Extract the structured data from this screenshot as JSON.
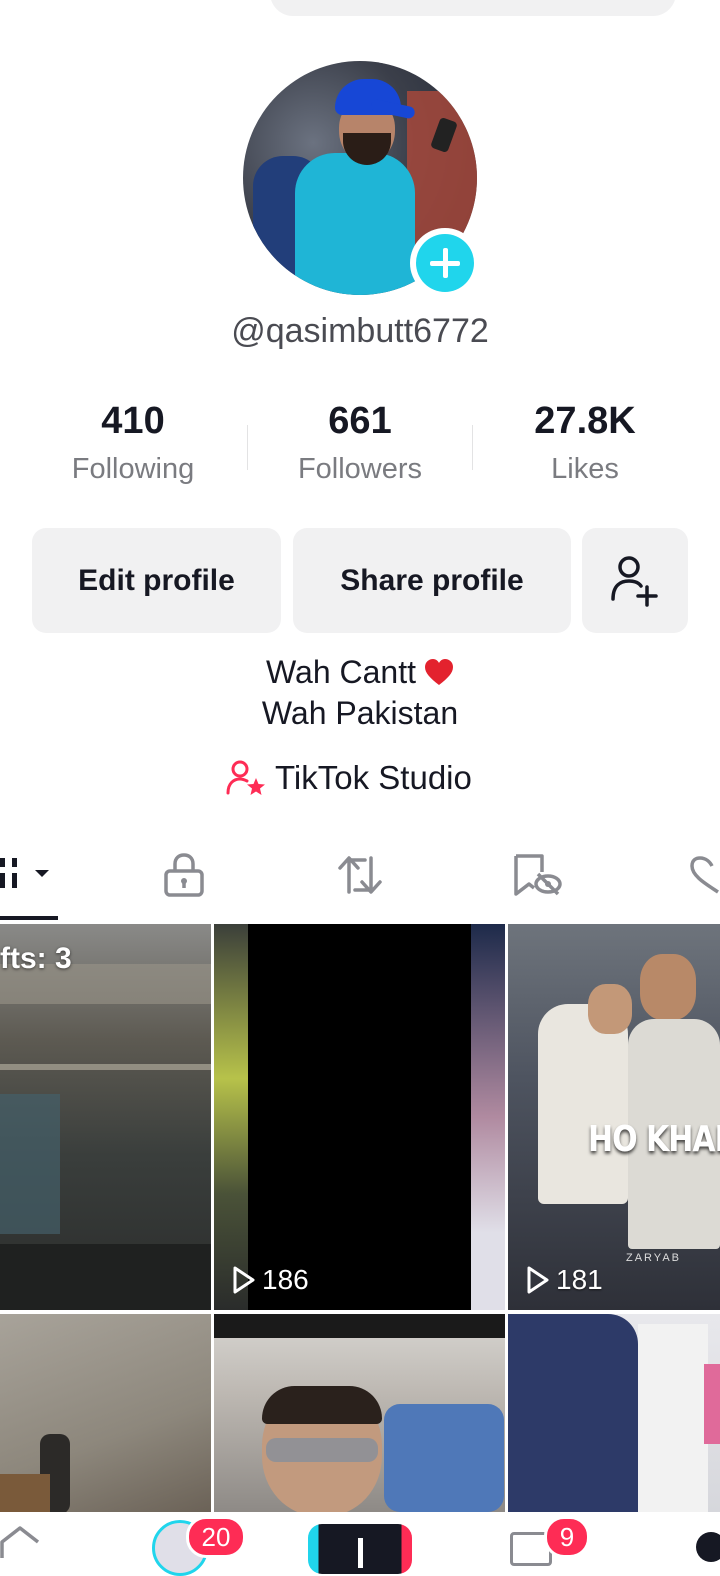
{
  "profile": {
    "username": "@qasimbutt6772",
    "stats": [
      {
        "value": "410",
        "label": "Following"
      },
      {
        "value": "661",
        "label": "Followers"
      },
      {
        "value": "27.8K",
        "label": "Likes"
      }
    ],
    "buttons": {
      "edit": "Edit profile",
      "share": "Share profile"
    },
    "bio": [
      "Wah Cantt",
      "Wah Pakistan"
    ],
    "studio_link": "TikTok Studio"
  },
  "tabs": [
    {
      "icon": "grid-icon",
      "active": true
    },
    {
      "icon": "lock-icon"
    },
    {
      "icon": "repost-icon"
    },
    {
      "icon": "favorites-hidden-icon"
    },
    {
      "icon": "liked-icon"
    }
  ],
  "grid": {
    "drafts_label": "fts: 3",
    "tiles": [
      {
        "views": ""
      },
      {
        "views": "186"
      },
      {
        "views": "181",
        "overlay": "HO KHADE PA",
        "watermark": "ZARYAB"
      },
      {
        "views": ""
      },
      {
        "views": ""
      },
      {
        "views": ""
      }
    ]
  },
  "bottom_nav": {
    "friends_badge": "20",
    "inbox_badge": "9"
  },
  "colors": {
    "accent": "#fe2c55",
    "teal": "#20d5ec",
    "button_bg": "#f1f1f2"
  }
}
